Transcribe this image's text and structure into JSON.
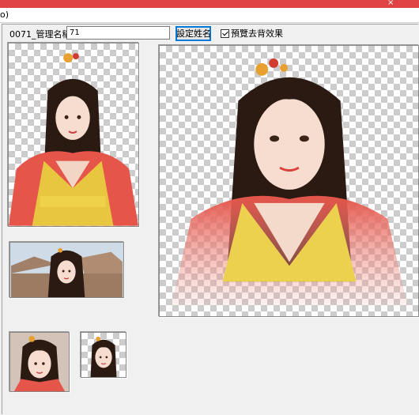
{
  "window": {
    "close_glyph": "×"
  },
  "menu": {
    "first_item": "o)"
  },
  "form": {
    "name_label": "0071_管理名稱:",
    "name_value": "71",
    "set_button": "設定姓名",
    "preview_checkbox_label": "預覽去背效果",
    "preview_checked": true
  },
  "icons": [
    "portrait-image",
    "banner-image",
    "avatar-image"
  ]
}
